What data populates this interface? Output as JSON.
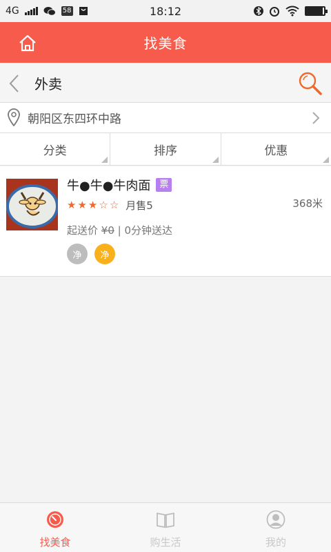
{
  "status": {
    "network": "4G",
    "app_badge": "58",
    "time": "18:12"
  },
  "header": {
    "title": "找美食",
    "subtitle": "外卖",
    "address": "朝阳区东四环中路"
  },
  "filters": [
    "分类",
    "排序",
    "优惠"
  ],
  "restaurant": {
    "name": "牛●牛●牛肉面",
    "invoice_badge": "票",
    "rating": 3,
    "rating_max": 5,
    "monthly_sales": "月售5",
    "distance": "368米",
    "min_order_label": "起送价",
    "min_order_value": "¥0",
    "delivery_time": "| 0分钟送达",
    "tags": [
      "净",
      "净"
    ]
  },
  "tabs": [
    "找美食",
    "购生活",
    "我的"
  ],
  "colors": {
    "accent": "#f75b4c",
    "invoice_badge": "#b77ff0",
    "tag_grey": "#bdbdbd",
    "tag_yellow": "#f8b01b"
  }
}
